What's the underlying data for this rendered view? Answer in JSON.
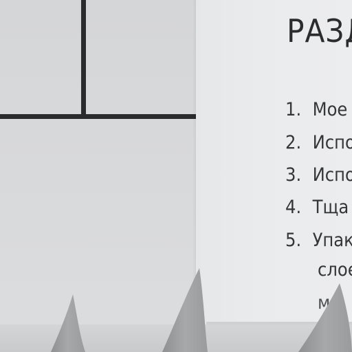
{
  "document": {
    "title": "РАЗД",
    "items": [
      {
        "number": "1.",
        "text": "Мое"
      },
      {
        "number": "2.",
        "text": "Испо"
      },
      {
        "number": "3.",
        "text": "Испо"
      },
      {
        "number": "4.",
        "text": "Тща"
      },
      {
        "number": "5.",
        "text": "Упак"
      }
    ],
    "continuation_lines": [
      "слое",
      "м"
    ]
  }
}
